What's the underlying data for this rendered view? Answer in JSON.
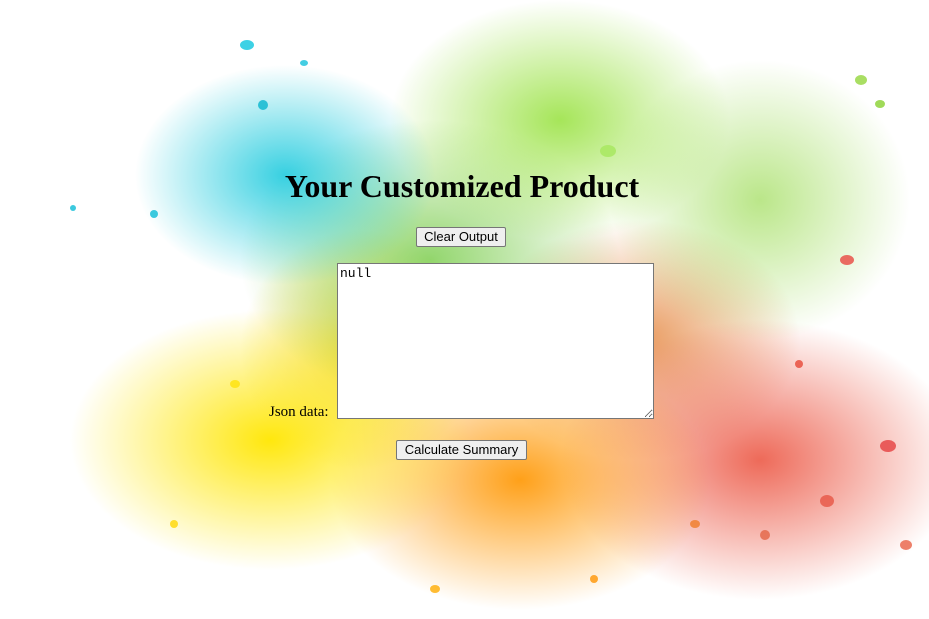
{
  "page": {
    "title": "Your Customized Product",
    "clear_button_label": "Clear Output",
    "json_label": "Json data:",
    "json_value": "null",
    "calculate_button_label": "Calculate Summary"
  },
  "colors": {
    "background": "#ffffff",
    "button_bg": "#efefef",
    "button_border": "#767676",
    "splash_cyan": "#14c8dc",
    "splash_green": "#96e13c",
    "splash_yellow": "#ffe600",
    "splash_orange": "#ff9600",
    "splash_red": "#eb503c"
  }
}
